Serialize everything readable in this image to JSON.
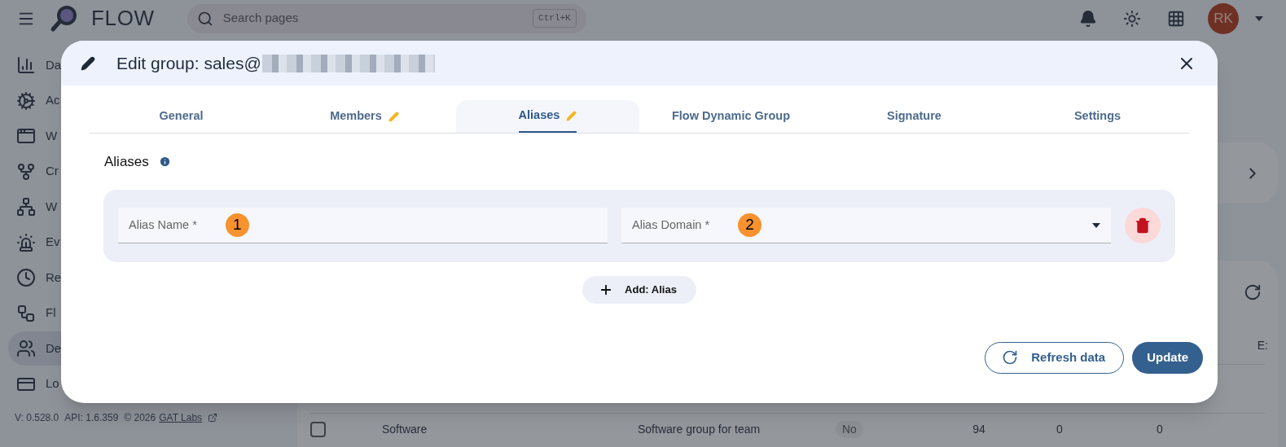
{
  "app": {
    "logo": "FLOW",
    "search_placeholder": "Search pages",
    "shortcut": "Ctrl+K",
    "avatar": "RK"
  },
  "sidebar": {
    "items": [
      {
        "label": "Da",
        "selected": false
      },
      {
        "label": "Ac",
        "selected": false
      },
      {
        "label": "W",
        "selected": false
      },
      {
        "label": "Cr",
        "selected": false
      },
      {
        "label": "W",
        "selected": false
      },
      {
        "label": "Ev",
        "selected": false
      },
      {
        "label": "Re",
        "selected": false
      },
      {
        "label": "Fl",
        "selected": false
      },
      {
        "label": "De",
        "selected": true
      },
      {
        "label": "Lo",
        "selected": false
      }
    ],
    "footer": {
      "version": "V: 0.528.0",
      "api": "API: 1.6.359",
      "copyright": "© 2026",
      "link": "GAT Labs"
    }
  },
  "background_table": {
    "column_7": "E:",
    "rows": [
      {
        "checked": false,
        "cells": [
          "Software",
          "Software group for team",
          "No",
          "94",
          "0",
          "0"
        ]
      }
    ]
  },
  "dialog": {
    "title": "Edit group: sales@",
    "tabs": [
      {
        "label": "General",
        "selected": false,
        "edited": false
      },
      {
        "label": "Members",
        "selected": false,
        "edited": true
      },
      {
        "label": "Aliases",
        "selected": true,
        "edited": true
      },
      {
        "label": "Flow Dynamic Group",
        "selected": false,
        "edited": false
      },
      {
        "label": "Signature",
        "selected": false,
        "edited": false
      },
      {
        "label": "Settings",
        "selected": false,
        "edited": false
      }
    ],
    "section_title": "Aliases",
    "fields": [
      {
        "kind": "text",
        "placeholder": "Alias Name *",
        "marker": "1"
      },
      {
        "kind": "select",
        "placeholder": "Alias Domain *",
        "marker": "2"
      }
    ],
    "add_button": "Add: Alias",
    "buttons": [
      {
        "kind": "outline",
        "label": "Refresh data"
      },
      {
        "kind": "primary",
        "label": "Update"
      }
    ]
  }
}
